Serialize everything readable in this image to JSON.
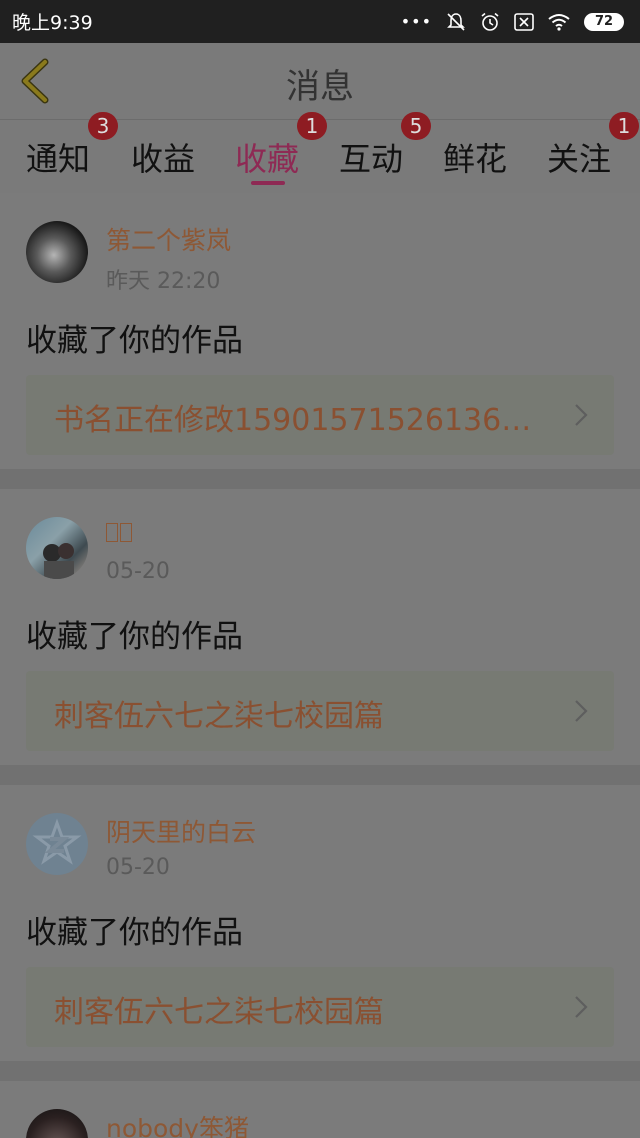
{
  "status_bar": {
    "time": "晚上9:39",
    "dots": "•••",
    "battery": "72"
  },
  "header": {
    "title": "消息"
  },
  "tabs": [
    {
      "label": "通知",
      "badge": "3"
    },
    {
      "label": "收益",
      "badge": ""
    },
    {
      "label": "收藏",
      "badge": "1"
    },
    {
      "label": "互动",
      "badge": "5"
    },
    {
      "label": "鲜花",
      "badge": ""
    },
    {
      "label": "关注",
      "badge": "1"
    }
  ],
  "messages": [
    {
      "user": "第二个紫岚",
      "time": "昨天 22:20",
      "action": "收藏了你的作品",
      "book": "书名正在修改15901571526136…"
    },
    {
      "user": "",
      "time": "05-20",
      "action": "收藏了你的作品",
      "book": "刺客伍六七之柒七校园篇"
    },
    {
      "user": "阴天里的白云",
      "time": "05-20",
      "action": "收藏了你的作品",
      "book": "刺客伍六七之柒七校园篇"
    },
    {
      "user": "nobody笨猪",
      "time": "",
      "action": "",
      "book": ""
    }
  ],
  "colors": {
    "accent": "#8e2a54",
    "badge": "#8e1c22",
    "username": "#8e5835",
    "book_title": "#8a5031"
  }
}
